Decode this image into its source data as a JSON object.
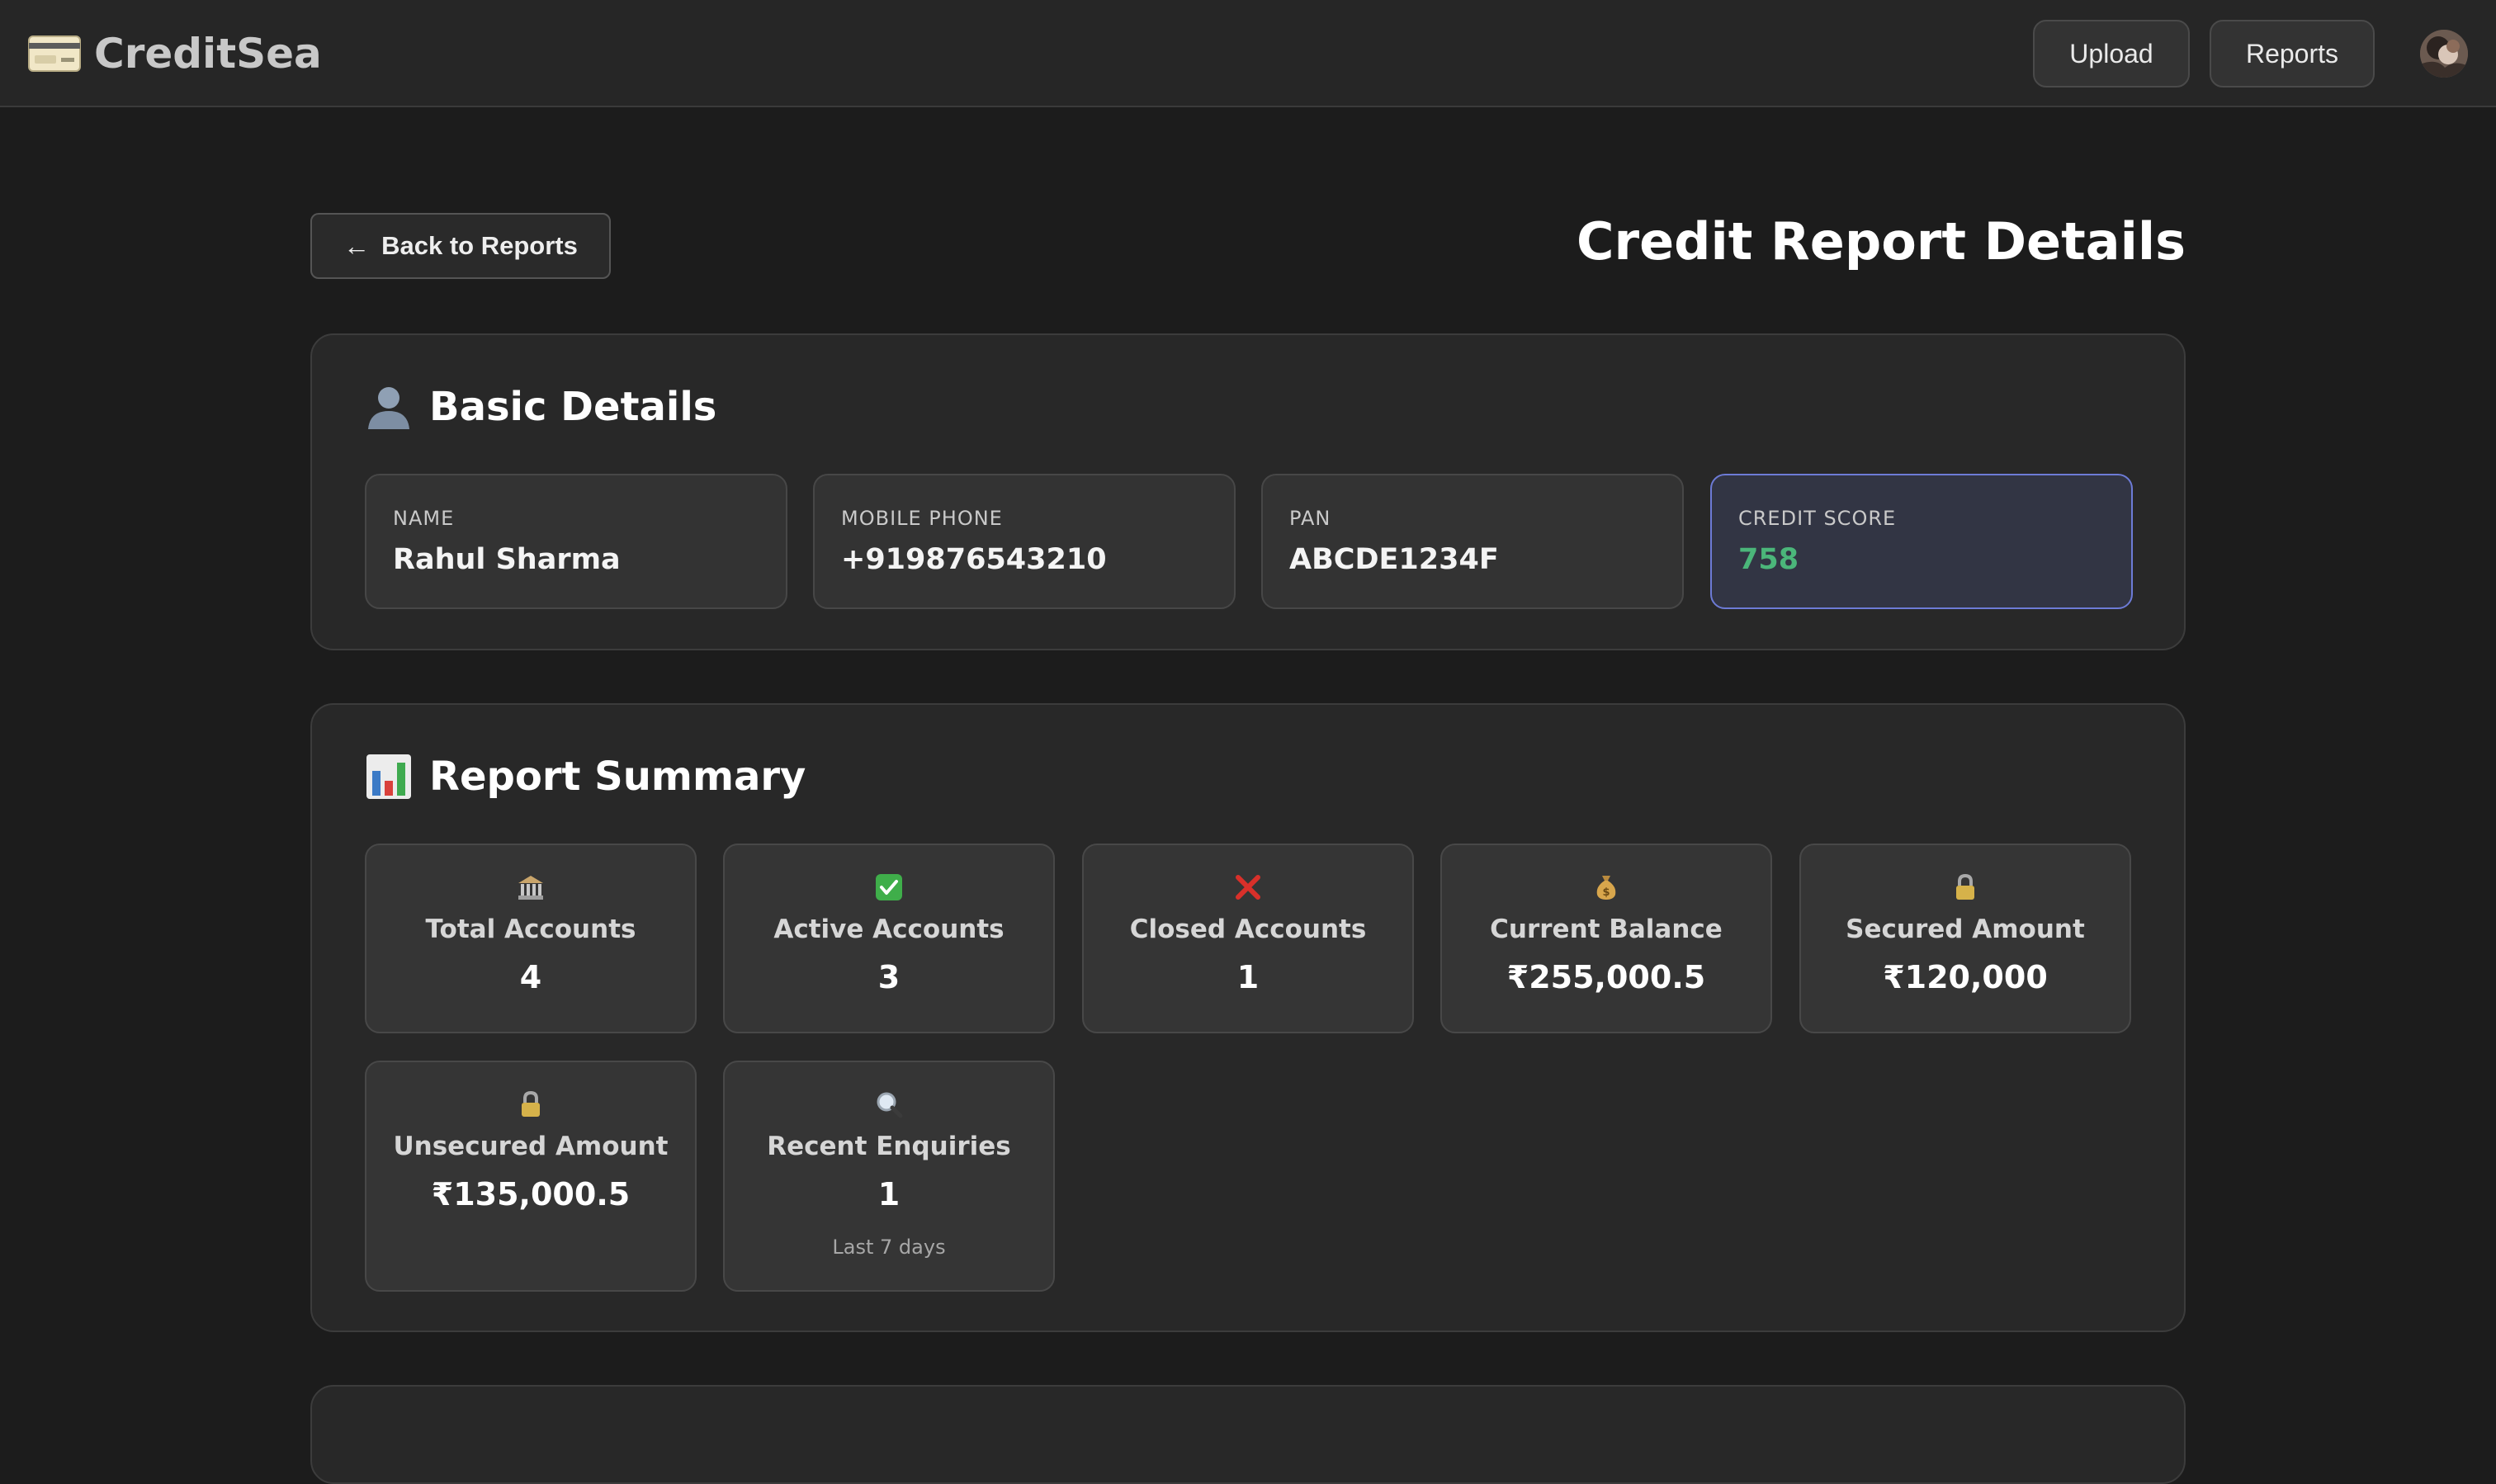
{
  "app": {
    "brand_name": "CreditSea",
    "nav": {
      "upload_label": "Upload",
      "reports_label": "Reports"
    }
  },
  "page": {
    "back_label": "Back to Reports",
    "title": "Credit Report Details"
  },
  "basic_details": {
    "title": "Basic Details",
    "icon": "user-silhouette-icon",
    "fields": [
      {
        "label": "NAME",
        "value": "Rahul Sharma"
      },
      {
        "label": "MOBILE PHONE",
        "value": "+919876543210"
      },
      {
        "label": "PAN",
        "value": "ABCDE1234F"
      },
      {
        "label": "CREDIT SCORE",
        "value": "758"
      }
    ],
    "score_color": "#4bb67a",
    "highlight_border": "#6d7bd6"
  },
  "report_summary": {
    "title": "Report Summary",
    "icon": "bar-chart-icon",
    "cards": [
      {
        "icon": "bank-icon",
        "label": "Total Accounts",
        "value": "4"
      },
      {
        "icon": "check-mark-icon",
        "label": "Active Accounts",
        "value": "3"
      },
      {
        "icon": "cross-mark-icon",
        "label": "Closed Accounts",
        "value": "1"
      },
      {
        "icon": "money-bag-icon",
        "label": "Current Balance",
        "value": "₹255,000.5"
      },
      {
        "icon": "lock-icon",
        "label": "Secured Amount",
        "value": "₹120,000"
      },
      {
        "icon": "lock-icon",
        "label": "Unsecured Amount",
        "value": "₹135,000.5"
      },
      {
        "icon": "magnifier-icon",
        "label": "Recent Enquiries",
        "value": "1",
        "note": "Last 7 days"
      }
    ]
  }
}
